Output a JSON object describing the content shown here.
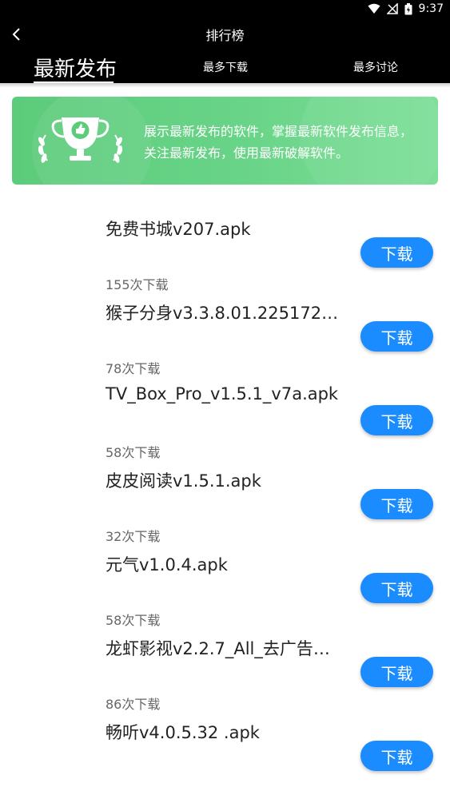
{
  "status": {
    "time": "9:37"
  },
  "header": {
    "title": "排行榜"
  },
  "tabs": [
    {
      "label": "最新发布",
      "active": true
    },
    {
      "label": "最多下载",
      "active": false
    },
    {
      "label": "最多讨论",
      "active": false
    }
  ],
  "banner": {
    "text": "展示最新发布的软件，掌握最新软件发布信息，关注最新发布，使用最新破解软件。"
  },
  "items": [
    {
      "name": "免费书城v207.apk",
      "button": "下载",
      "downloads": "155次下载"
    },
    {
      "name": "猴子分身v3.3.8.01.2251723…",
      "button": "下载",
      "downloads": "78次下载"
    },
    {
      "name": "TV_Box_Pro_v1.5.1_v7a.apk",
      "button": "下载",
      "downloads": "58次下载"
    },
    {
      "name": "皮皮阅读v1.5.1.apk",
      "button": "下载",
      "downloads": "32次下载"
    },
    {
      "name": "元气v1.0.4.apk",
      "button": "下载",
      "downloads": "58次下载"
    },
    {
      "name": "龙虾影视v2.2.7_All_去广告…",
      "button": "下载",
      "downloads": "86次下载"
    },
    {
      "name": "畅听v4.0.5.32 .apk",
      "button": "下载",
      "downloads": ""
    }
  ],
  "colors": {
    "accent": "#1a8cff",
    "banner": "#62cf82",
    "bar": "#000000"
  }
}
